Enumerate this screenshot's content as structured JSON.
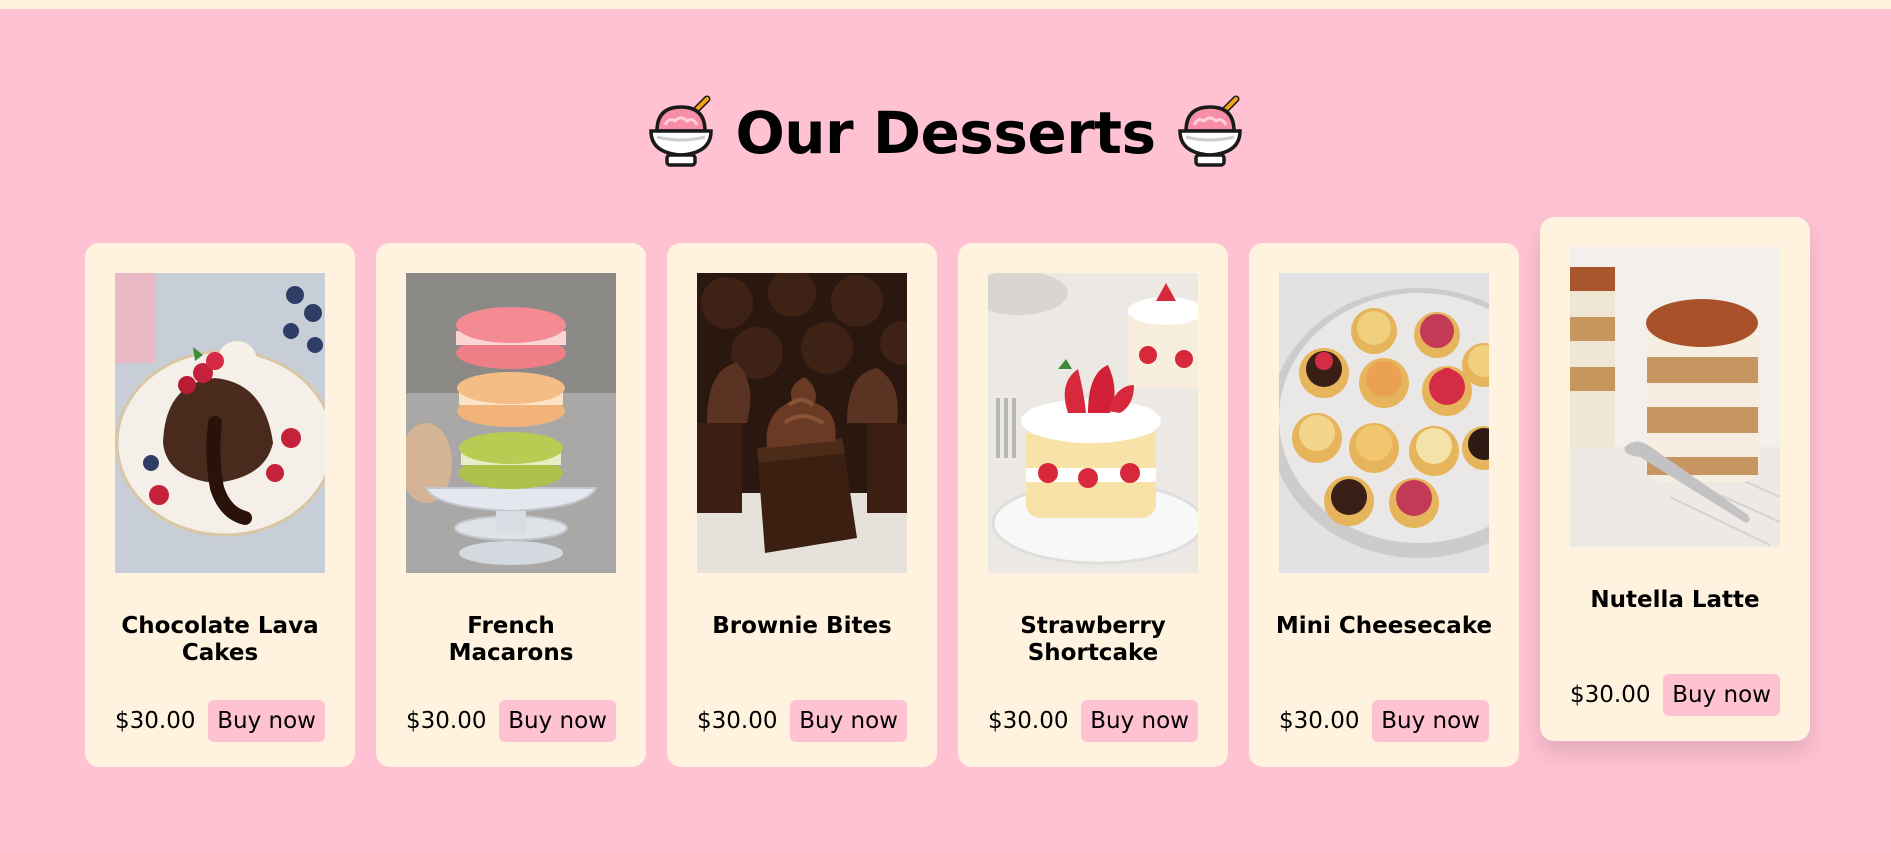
{
  "header": {
    "title": "Our Desserts",
    "icon": "ice-cream-bowl-icon"
  },
  "products": [
    {
      "name": "Chocolate Lava Cakes",
      "price": "$30.00",
      "button": "Buy now"
    },
    {
      "name": "French Macarons",
      "price": "$30.00",
      "button": "Buy now"
    },
    {
      "name": "Brownie Bites",
      "price": "$30.00",
      "button": "Buy now"
    },
    {
      "name": "Strawberry Shortcake",
      "price": "$30.00",
      "button": "Buy now"
    },
    {
      "name": "Mini Cheesecake",
      "price": "$30.00",
      "button": "Buy now"
    },
    {
      "name": "Nutella Latte",
      "price": "$30.00",
      "button": "Buy now"
    }
  ],
  "colors": {
    "background": "#ffc2d3",
    "card": "#fff3df",
    "top_strip": "#fff1dc",
    "button": "#ffc2d3"
  }
}
